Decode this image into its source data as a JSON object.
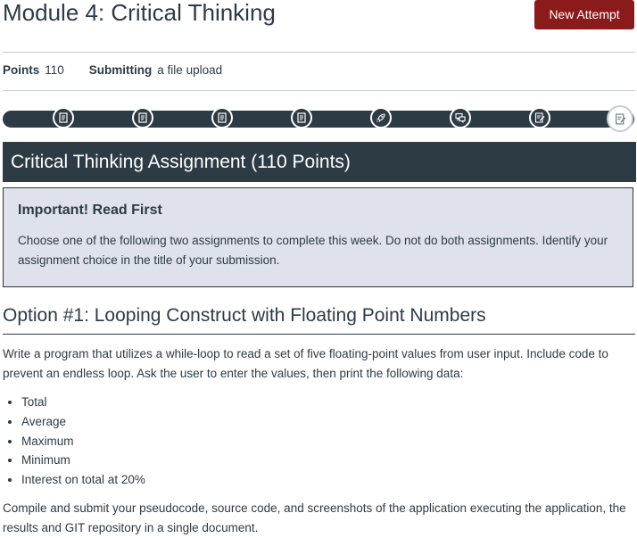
{
  "header": {
    "title": "Module 4: Critical Thinking",
    "new_attempt_label": "New Attempt"
  },
  "meta": {
    "points_label": "Points",
    "points_value": "110",
    "submitting_label": "Submitting",
    "submitting_value": "a file upload"
  },
  "module_progress": {
    "steps": [
      {
        "icon": "page-icon",
        "current": false
      },
      {
        "icon": "page-icon",
        "current": false
      },
      {
        "icon": "page-icon",
        "current": false
      },
      {
        "icon": "page-icon",
        "current": false
      },
      {
        "icon": "rocket-icon",
        "current": false
      },
      {
        "icon": "discussion-icon",
        "current": false
      },
      {
        "icon": "assignment-icon",
        "current": false
      },
      {
        "icon": "assignment-icon",
        "current": true
      }
    ]
  },
  "content": {
    "banner_title": "Critical Thinking Assignment (110 Points)",
    "callout": {
      "title": "Important! Read First",
      "body": "Choose one of the following two assignments to complete this week. Do not do both assignments. Identify your assignment choice in the title of your submission."
    },
    "option1": {
      "heading": "Option #1: Looping Construct with Floating Point Numbers",
      "intro": "Write a program that utilizes a while-loop to read a set of five floating-point values from user input. Include code to prevent an endless loop. Ask the user to enter the values, then print the following data:",
      "bullets": [
        "Total",
        "Average",
        "Maximum",
        "Minimum",
        "Interest on total at 20%"
      ],
      "outro": "Compile and submit your pseudocode, source code, and screenshots of the application executing the application, the results and GIT repository in a single document."
    }
  },
  "colors": {
    "accent_dark": "#2d3b45",
    "button_red": "#8b1a1a",
    "callout_bg": "#dfe2ec"
  }
}
